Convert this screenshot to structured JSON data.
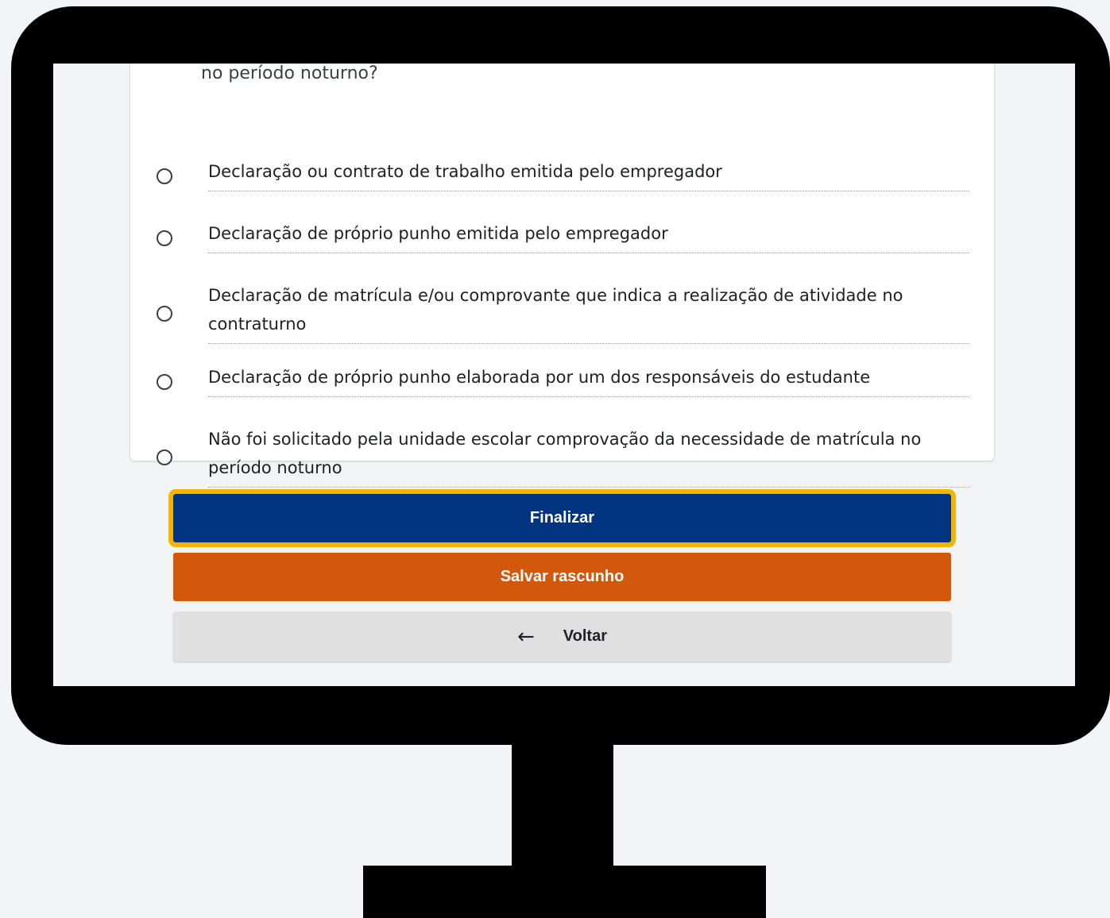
{
  "question": {
    "partial_text": "no período noturno?"
  },
  "options": [
    {
      "label": "Declaração ou contrato de trabalho emitida pelo empregador"
    },
    {
      "label": "Declaração de próprio punho emitida pelo empregador"
    },
    {
      "label": "Declaração de matrícula e/ou comprovante que indica a realização de atividade no contraturno"
    },
    {
      "label": "Declaração de próprio punho elaborada por um dos responsáveis do estudante"
    },
    {
      "label": "Não foi solicitado pela unidade escolar comprovação da necessidade de matrícula no período noturno"
    }
  ],
  "buttons": {
    "finalizar": "Finalizar",
    "salvar": "Salvar rascunho",
    "voltar": "Voltar",
    "voltar_icon": "arrow-left-icon"
  },
  "colors": {
    "primary": "#003380",
    "focus_outline": "#f5b400",
    "draft": "#d2580b",
    "secondary": "#e0e0e0"
  }
}
